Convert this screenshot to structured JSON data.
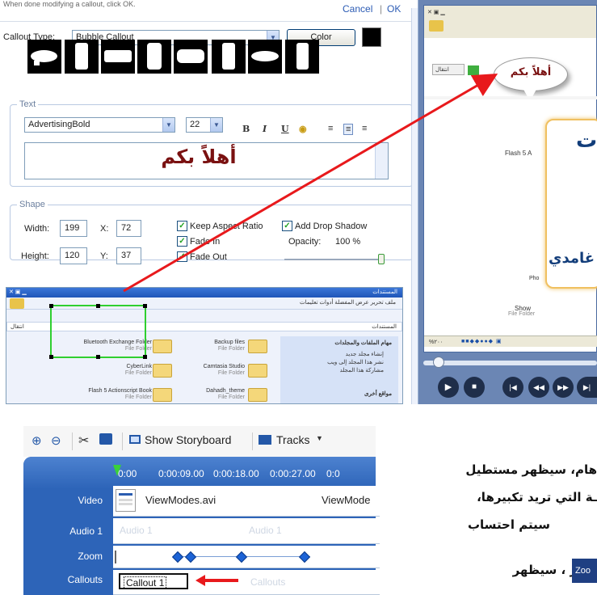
{
  "dialog": {
    "header_hint": "When done modifying a callout, click OK.",
    "cancel_label": "Cancel",
    "ok_label": "OK",
    "separator": "|",
    "callout_type_label": "Callout Type:",
    "callout_type_value": "Bubble Callout",
    "color_button": "Color",
    "color_swatch": "#000000",
    "text_section_title": "Text",
    "font_value": "AdvertisingBold",
    "size_value": "22",
    "bold_label": "B",
    "italic_label": "I",
    "underline_label": "U",
    "callout_text": "أهلاً بكم",
    "shape_section_title": "Shape",
    "width_label": "Width:",
    "width_value": "199",
    "x_label": "X:",
    "x_value": "72",
    "height_label": "Height:",
    "height_value": "120",
    "y_label": "Y:",
    "y_value": "37",
    "keep_aspect_label": "Keep Aspect Ratio",
    "fade_in_label": "Fade In",
    "fade_out_label": "Fade Out",
    "drop_shadow_label": "Add Drop Shadow",
    "opacity_label": "Opacity:",
    "opacity_value": "100 %"
  },
  "mini_explorer": {
    "title": "المستندات",
    "menu": "ملف  تحرير  عرض  المفضلة  أدوات  تعليمات",
    "address_label": "عنوان",
    "address_value": "المستندات",
    "go_label": "انتقال",
    "tasks_title": "مهام الملفات والمجلدات",
    "task1": "إنشاء مجلد جديد",
    "task2": "نشر هذا المجلد إلى ويب",
    "task3": "مشاركة هذا المجلد",
    "other_places": "مواقع أخرى",
    "folders": [
      {
        "name": "Bluetooth Exchange Folder",
        "type": "File Folder"
      },
      {
        "name": "Backup files",
        "type": "File Folder"
      },
      {
        "name": "CyberLink",
        "type": "File Folder"
      },
      {
        "name": "Camtasia Studio",
        "type": "File Folder"
      },
      {
        "name": "Flash 5 Actionscript Book",
        "type": "File Folder"
      },
      {
        "name": "Dahadh_theme",
        "type": "File Folder"
      }
    ]
  },
  "preview": {
    "go_label": "انتقال",
    "bubble_text": "أهلاً بكم",
    "flash_label": "Flash 5 A",
    "slide_text1": "ت",
    "slide_text2": "غامدي",
    "ph_label": "Pho",
    "show_label": "Show",
    "file_folder": "File Folder",
    "zoom_value": "%۲۰۰"
  },
  "timeline": {
    "show_storyboard": "Show Storyboard",
    "tracks": "Tracks",
    "timecodes": [
      "0:00",
      "0:00:09.00",
      "0:00:18.00",
      "0:00:27.00",
      "0:0"
    ],
    "video_label": "Video",
    "audio_label": "Audio 1",
    "zoom_label": "Zoom",
    "callouts_label": "Callouts",
    "video_clip1": "ViewModes.avi",
    "video_clip2": "ViewMode",
    "audio_ghost1": "Audio 1",
    "audio_ghost2": "Audio 1",
    "callout_clip": "Callout 1",
    "callouts_ghost": "Callouts"
  },
  "arabic_text": {
    "line1": "هام، سيظهر مستطيل",
    "line2": "ـة التي تريد تكبيرها،",
    "line3": "سيتم احتساب",
    "line4": "إطار ، سيظهر",
    "zoom_chip": "Zoo"
  },
  "colors": {
    "arrow": "#e8191c",
    "timeline_bg": "#2d64b8",
    "green_frame": "#2fcf2f"
  }
}
